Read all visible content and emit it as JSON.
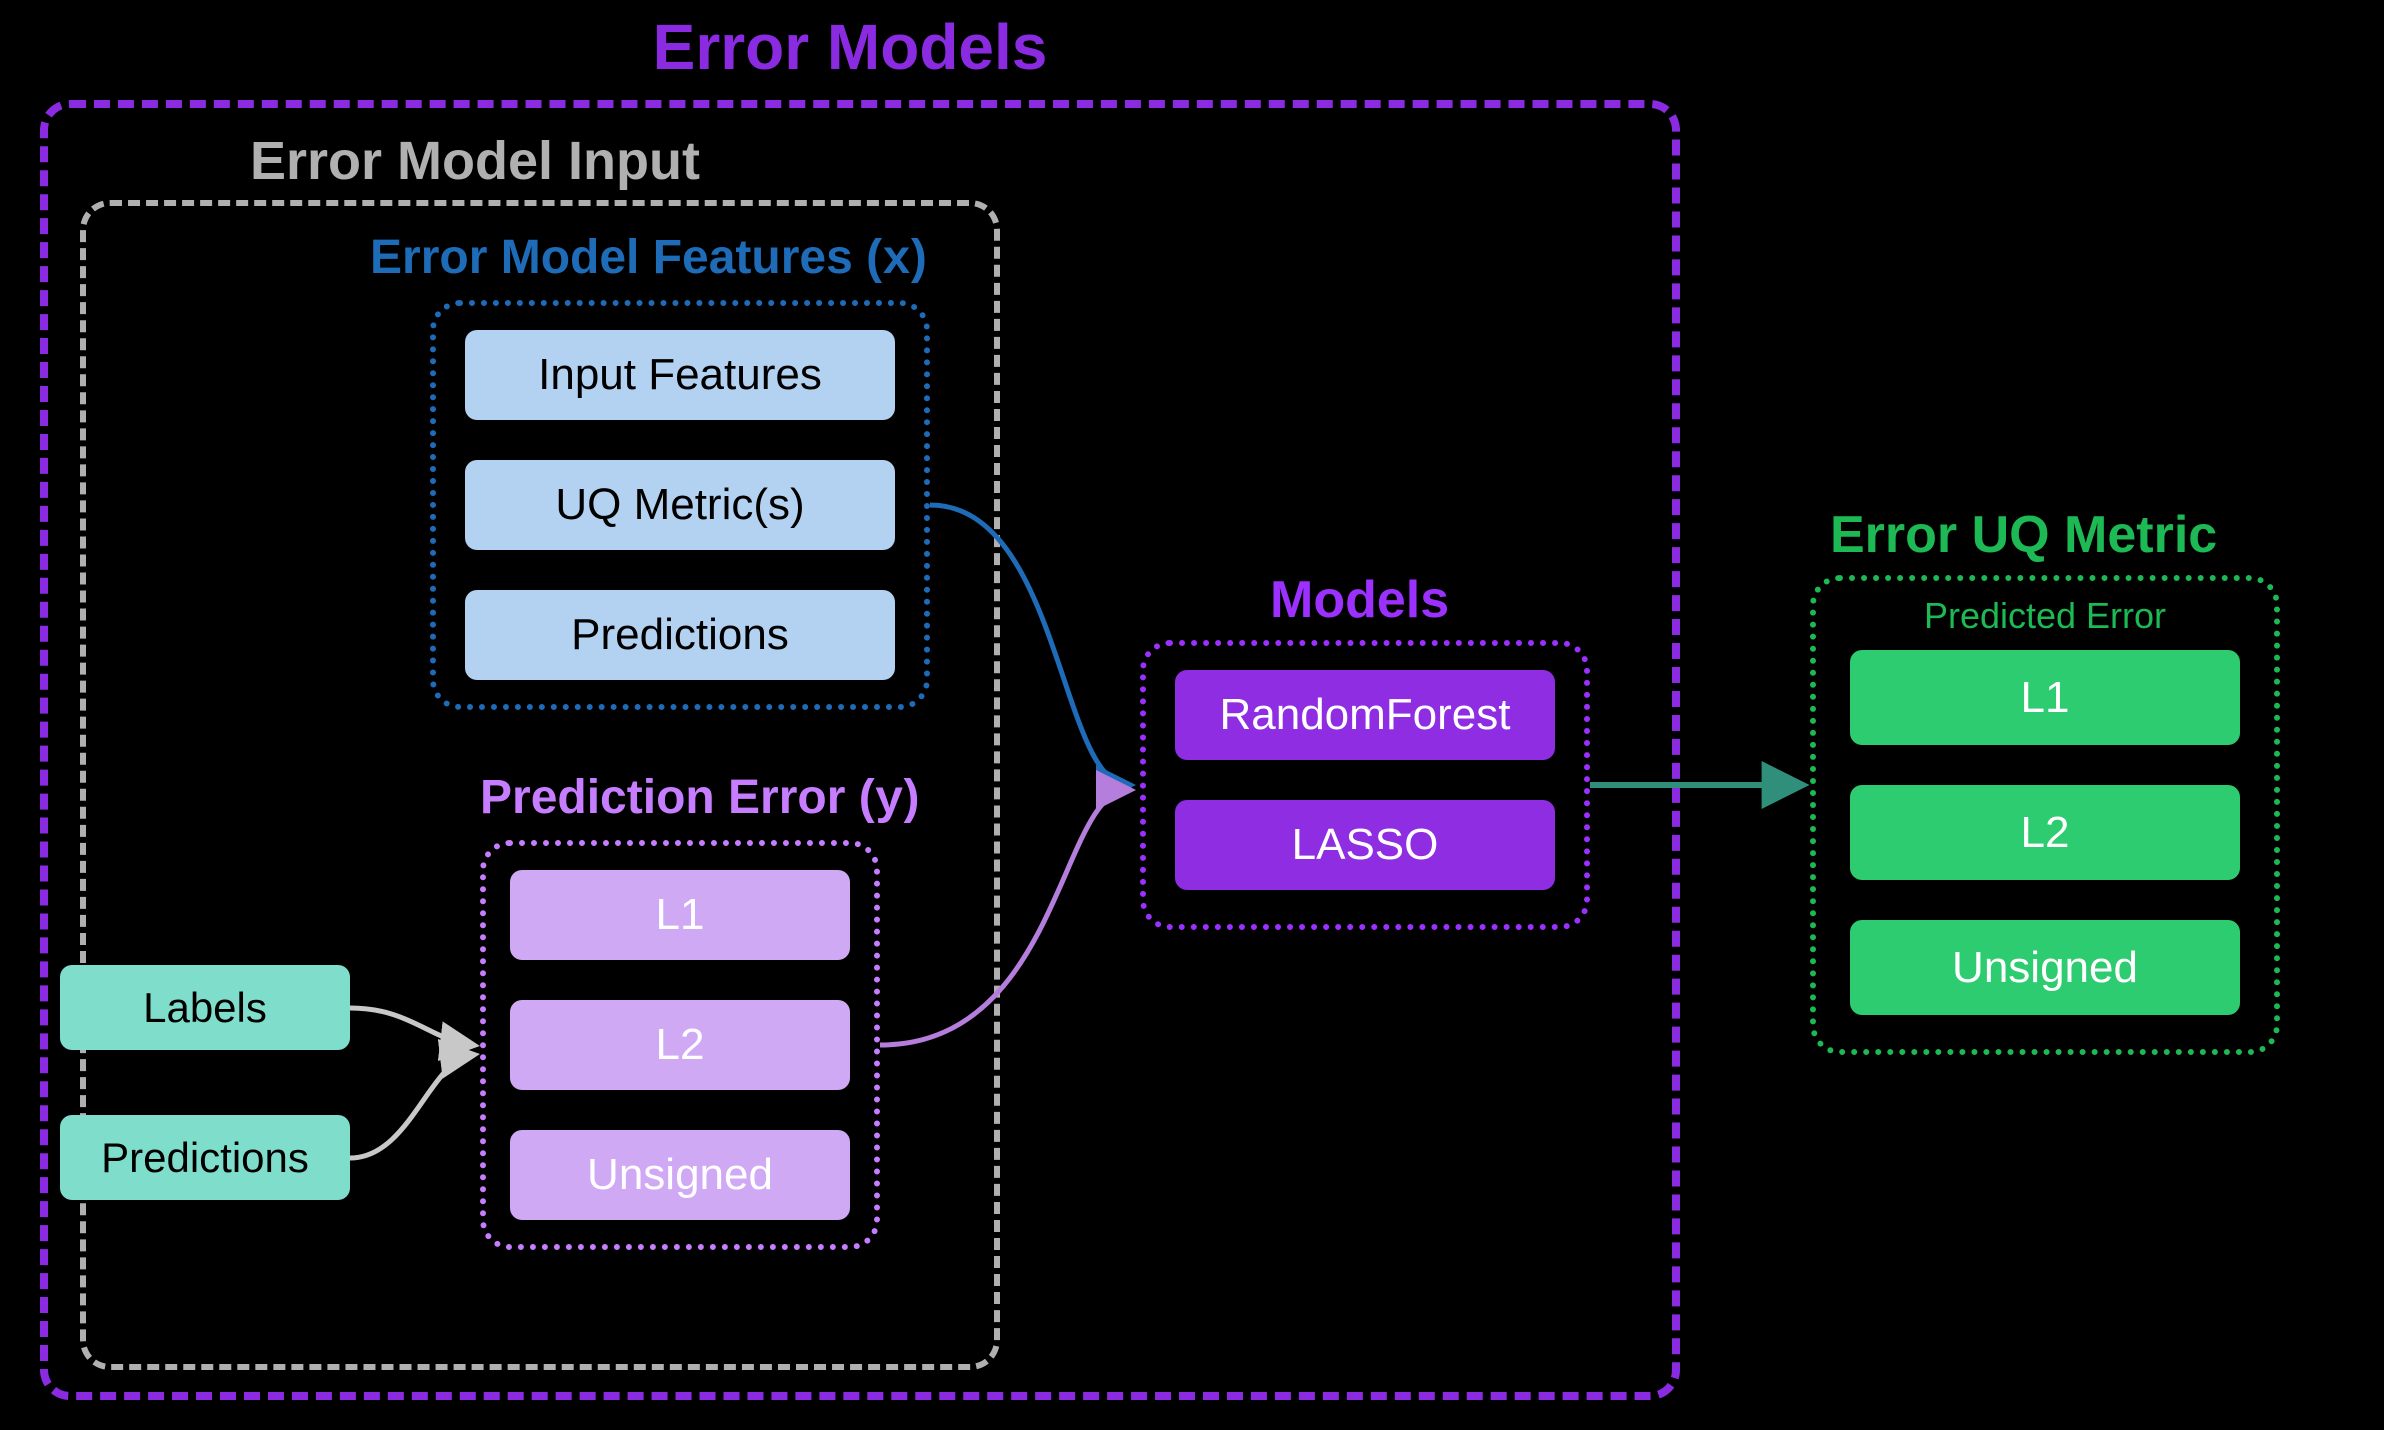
{
  "outer": {
    "title": "Error Models",
    "color": "#8a2be2"
  },
  "input_group": {
    "title": "Error Model Input",
    "color": "#b0b0b0"
  },
  "features_group": {
    "title_prefix": "Error Model Features (",
    "title_var": "x",
    "title_suffix": ")",
    "color": "#1e6bb8",
    "items": [
      "Input Features",
      "UQ Metric(s)",
      "Predictions"
    ],
    "item_bg": "#b3d1f0",
    "item_text": "#000"
  },
  "prediction_error_group": {
    "title_prefix": "Prediction Error (",
    "title_var": "y",
    "title_suffix": ")",
    "color": "#c77dff",
    "items": [
      "L1",
      "L2",
      "Unsigned"
    ],
    "item_bg": "#d0a9f5",
    "item_text": "#fff"
  },
  "small_inputs": {
    "items": [
      "Labels",
      "Predictions"
    ],
    "bg": "#7fdecb",
    "text": "#000",
    "arrow_color": "#c8c8c8"
  },
  "models_group": {
    "title": "Models",
    "color": "#9b30ff",
    "items": [
      "RandomForest",
      "LASSO"
    ],
    "item_bg": "#8e2de2",
    "item_text": "#fff"
  },
  "error_uq_group": {
    "title": "Error UQ Metric",
    "subtitle": "Predicted Error",
    "color": "#1db954",
    "items": [
      "L1",
      "L2",
      "Unsigned"
    ],
    "item_bg": "#2ecc71",
    "item_text": "#fff"
  },
  "arrows": {
    "features_to_models": "#1e6bb8",
    "pe_to_models": "#b57edc",
    "models_to_uq": "#2f8f7a"
  }
}
